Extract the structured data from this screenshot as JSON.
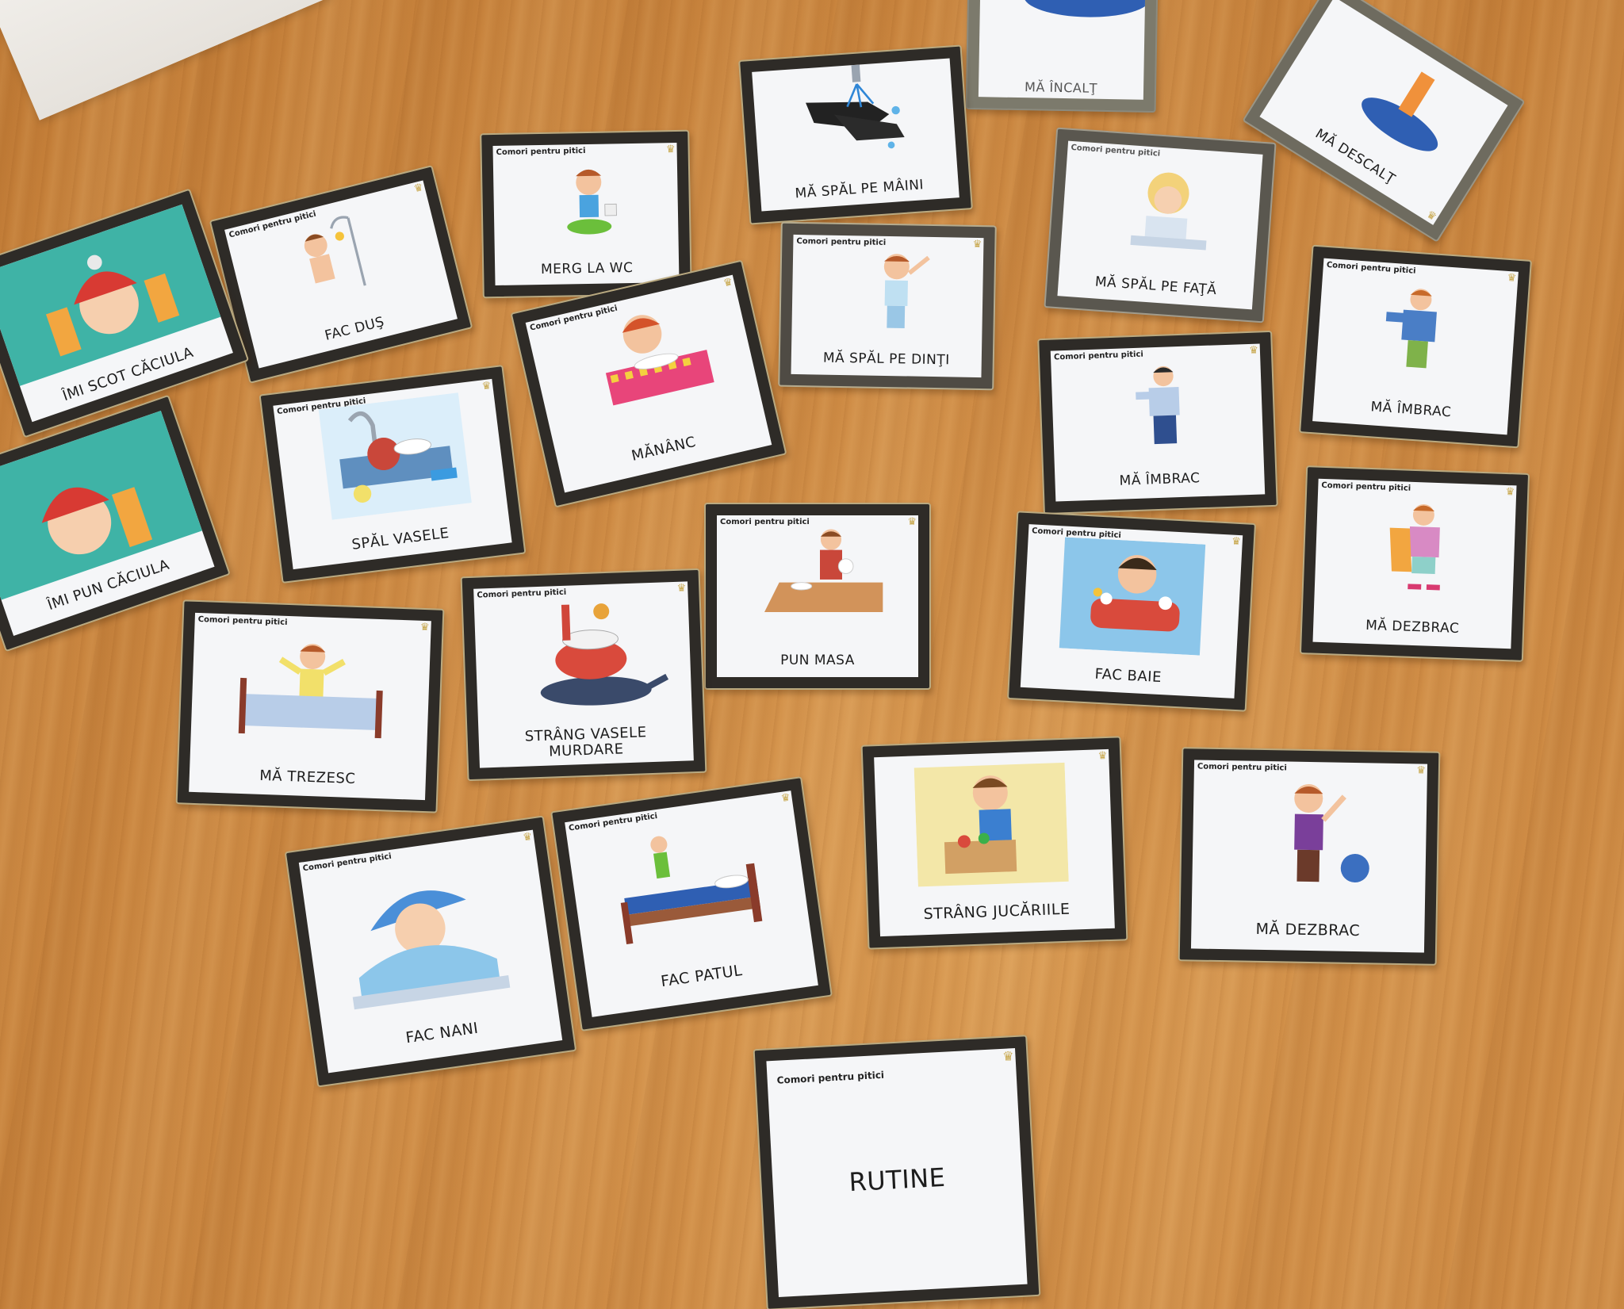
{
  "scene": {
    "surface": "wooden floor",
    "wood_color": "#cf8c45"
  },
  "brand_text": "Comori pentru pitici",
  "colors": {
    "card_border": "#2e2b27",
    "card_face": "#f5f6f8",
    "accent_gold": "#c7a64a"
  },
  "cards": [
    {
      "label": "MĂ ÎNCALŢ",
      "brand": ""
    },
    {
      "label": "MĂ DESCALŢ",
      "brand": ""
    },
    {
      "label": "MĂ SPĂL PE MÂINI",
      "brand": ""
    },
    {
      "label": "MERG LA WC",
      "brand": "Comori pentru pitici"
    },
    {
      "label": "MĂ SPĂL PE FAŢĂ",
      "brand": "Comori pentru pitici"
    },
    {
      "label": "FAC DUŞ",
      "brand": "Comori pentru pitici"
    },
    {
      "label": "ÎMI SCOT CĂCIULA",
      "brand": "Comori pentru pitici"
    },
    {
      "label": "MĂ SPĂL PE DINŢI",
      "brand": "Comori pentru pitici"
    },
    {
      "label": "MĂ ÎMBRAC",
      "brand": "Comori pentru pitici"
    },
    {
      "label": "MĂNÂNC",
      "brand": "Comori pentru pitici"
    },
    {
      "label": "SPĂL VASELE",
      "brand": "Comori pentru pitici"
    },
    {
      "label": "MĂ ÎMBRAC",
      "brand": "Comori pentru pitici"
    },
    {
      "label": "ÎMI PUN CĂCIULA",
      "brand": ""
    },
    {
      "label": "MĂ DEZBRAC",
      "brand": "Comori pentru pitici"
    },
    {
      "label": "PUN MASA",
      "brand": "Comori pentru pitici"
    },
    {
      "label": "FAC BAIE",
      "brand": "Comori pentru pitici"
    },
    {
      "label": "MĂ TREZESC",
      "brand": "Comori pentru pitici"
    },
    {
      "label": "STRÂNG VASELE MURDARE",
      "brand": "Comori pentru pitici"
    },
    {
      "label": "STRÂNG JUCĂRIILE",
      "brand": ""
    },
    {
      "label": "MĂ DEZBRAC",
      "brand": "Comori pentru pitici"
    },
    {
      "label": "FAC NANI",
      "brand": "Comori pentru pitici"
    },
    {
      "label": "FAC PATUL",
      "brand": "Comori pentru pitici"
    },
    {
      "label": "RUTINE",
      "brand": "Comori pentru pitici"
    }
  ]
}
